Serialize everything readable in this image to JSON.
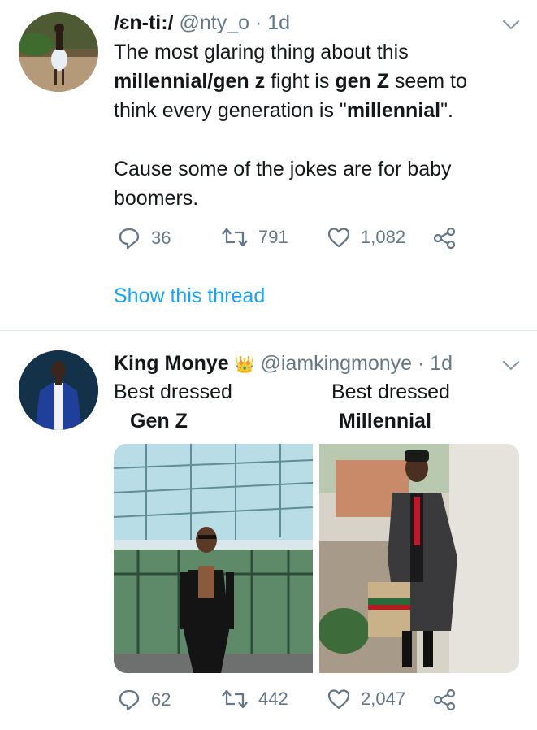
{
  "tweet1": {
    "display_name": "/ɛn-ti:/",
    "handle": "@nty_o",
    "separator": "·",
    "time": "1d",
    "text": {
      "line1": "The most glaring thing about this",
      "line2_bold_a": "millennial/gen z",
      "line2_mid": " fight is ",
      "line2_bold_b": "gen Z",
      "line2_end": " seem to",
      "line3_start": "think every generation is \"",
      "line3_bold": "millennial",
      "line3_end": "\".",
      "line4": "Cause some of the jokes are for baby",
      "line5": "boomers."
    },
    "replies": "36",
    "retweets": "791",
    "likes": "1,082",
    "show_thread": "Show this thread"
  },
  "tweet2": {
    "display_name": "King Monye",
    "badge_emoji": "👑",
    "handle": "@iamkingmonye",
    "separator": "·",
    "time": "1d",
    "caption_left_1": "Best dressed",
    "caption_left_2": "Gen Z",
    "caption_right_1": "Best dressed",
    "caption_right_2": "Millennial",
    "replies": "62",
    "retweets": "442",
    "likes": "2,047"
  },
  "icons": {
    "reply": "reply-icon",
    "retweet": "retweet-icon",
    "like": "heart-icon",
    "share": "share-icon",
    "more": "chevron-down-icon"
  },
  "colors": {
    "link": "#1da1f2",
    "meta": "#657786",
    "divider": "#e1e8ed"
  }
}
